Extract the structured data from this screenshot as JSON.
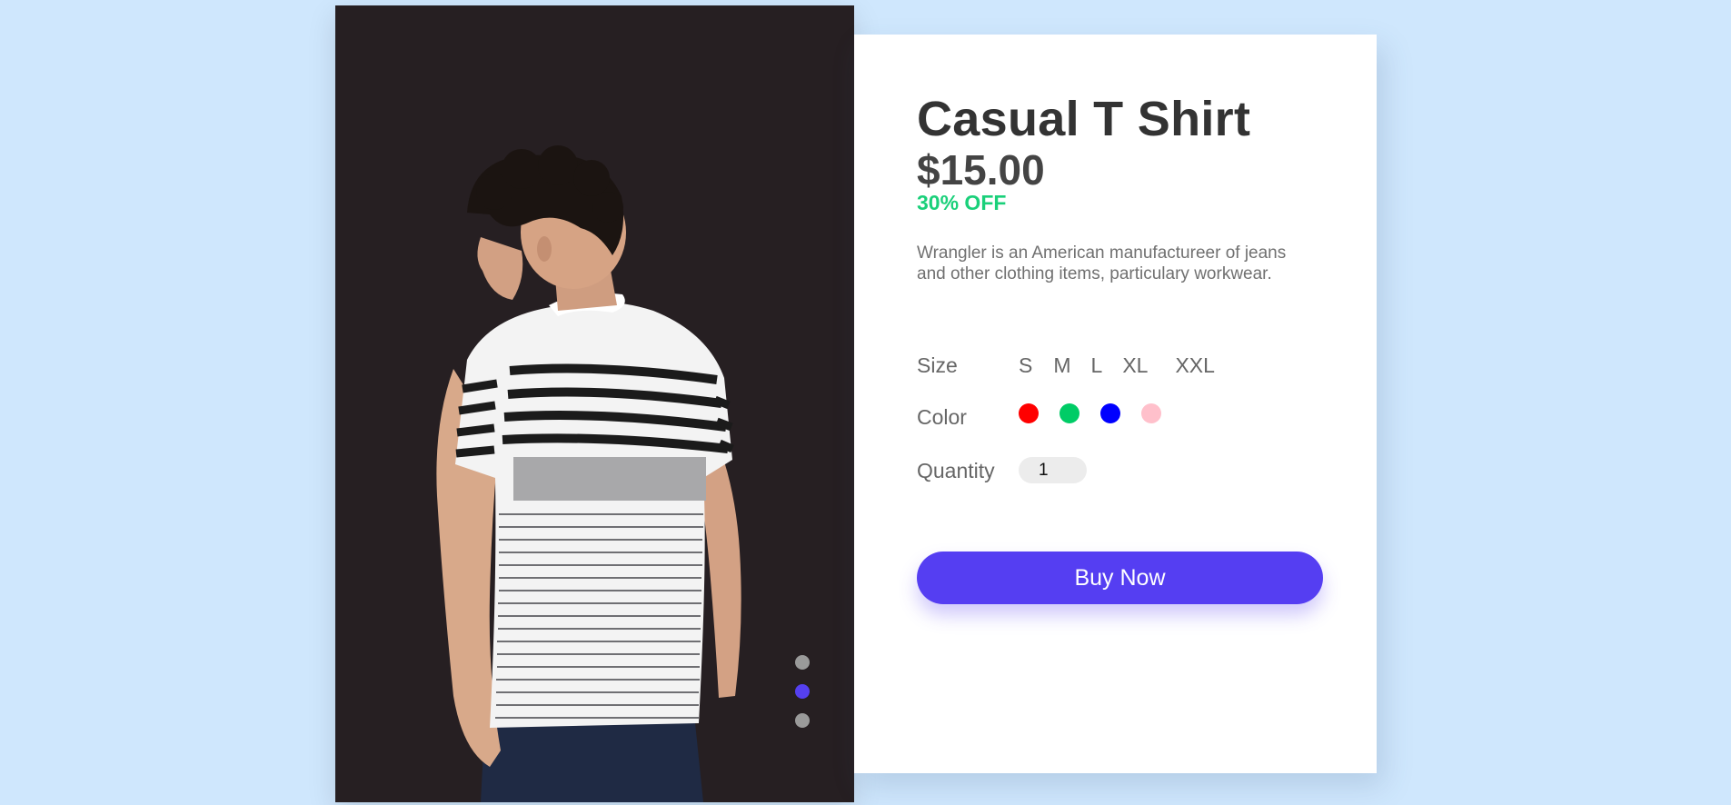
{
  "product": {
    "title": "Casual T Shirt",
    "price": "$15.00",
    "discount": "30% OFF",
    "description": "Wrangler is an American manufactureer of jeans and other clothing items, particulary workwear."
  },
  "options": {
    "size_label": "Size",
    "sizes": [
      "S",
      "M",
      "L",
      "XL",
      "XXL"
    ],
    "color_label": "Color",
    "colors": [
      "#ff0000",
      "#00cc66",
      "#0000ff",
      "#ffc0cb"
    ],
    "quantity_label": "Quantity",
    "quantity_value": "1"
  },
  "actions": {
    "buy_label": "Buy Now"
  },
  "carousel": {
    "active_index": 1,
    "dot_colors": {
      "inactive": "#9a9a9a",
      "active": "#5540f0"
    }
  },
  "theme": {
    "background": "#cfe7fd",
    "accent": "#553ef2",
    "discount_color": "#1ad07a"
  }
}
